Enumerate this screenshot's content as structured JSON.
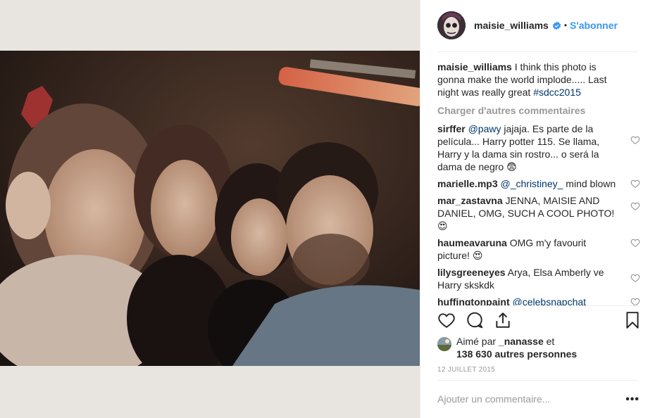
{
  "post": {
    "username": "maisie_williams",
    "separator": "•",
    "follow_label": "S'abonner",
    "caption": {
      "username": "maisie_williams",
      "text": " I think this photo is gonna make the world implode..... Last night was really great ",
      "hashtag": "#sdcc2015"
    },
    "load_more_label": "Charger d'autres commentaires"
  },
  "comments": [
    {
      "username": "sirffer",
      "mention": "@pawy",
      "text": " jajaja. Es parte de la película... Harry potter 115. Se llama, Harry y la dama sin rostro... o será la dama de negro ",
      "emoji": "😨"
    },
    {
      "username": "marielle.mp3",
      "mention": "@_christiney_",
      "text": " mind blown",
      "emoji": ""
    },
    {
      "username": "mar_zastavna",
      "mention": "",
      "text": " JENNA, MAISIE AND DANIEL, OMG, SUCH A COOL PHOTO! ",
      "emoji": "😍"
    },
    {
      "username": "haumeavaruna",
      "mention": "",
      "text": " OMG m'y favourit picture! ",
      "emoji": "😍"
    },
    {
      "username": "lilysgreeneyes",
      "mention": "",
      "text": " Arya, Elsa Amberly ve Harry skskdk",
      "emoji": ""
    },
    {
      "username": "huffingtonpaint",
      "mention": "@celebsnapchat",
      "text": "",
      "emoji": ""
    }
  ],
  "likes": {
    "prefix": "Aimé par ",
    "user": "_nanasse",
    "middle": " et",
    "count": "138 630 autres personnes"
  },
  "date": "12 JUILLET 2015",
  "add_comment_placeholder": "Ajouter un commentaire...",
  "more_label": "•••",
  "colors": {
    "link_blue": "#3897f0",
    "mention_blue": "#003569",
    "muted": "#999999",
    "text": "#262626"
  },
  "icons": [
    "verified-badge-icon",
    "heart-icon",
    "comment-icon",
    "share-icon",
    "bookmark-icon",
    "heart-small-icon",
    "more-options-icon"
  ]
}
